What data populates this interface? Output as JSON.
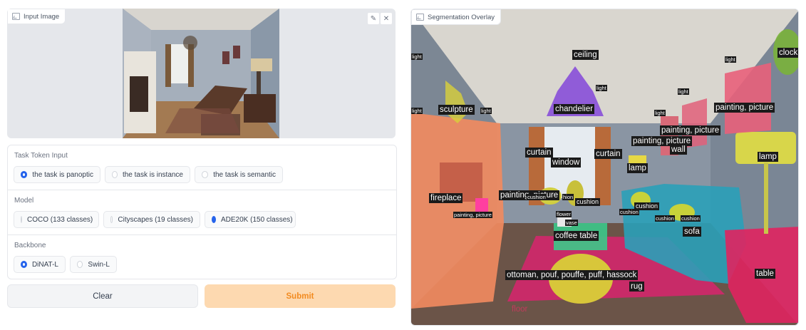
{
  "input_panel": {
    "label": "Input Image",
    "icon": "image-icon",
    "edit_icon": "pencil-icon",
    "close_icon": "close-icon"
  },
  "task": {
    "title": "Task Token Input",
    "options": [
      {
        "label": "the task is panoptic",
        "selected": true
      },
      {
        "label": "the task is instance",
        "selected": false
      },
      {
        "label": "the task is semantic",
        "selected": false
      }
    ]
  },
  "model": {
    "title": "Model",
    "options": [
      {
        "label": "COCO (133 classes)",
        "selected": false
      },
      {
        "label": "Cityscapes (19 classes)",
        "selected": false
      },
      {
        "label": "ADE20K (150 classes)",
        "selected": true
      }
    ]
  },
  "backbone": {
    "title": "Backbone",
    "options": [
      {
        "label": "DiNAT-L",
        "selected": true
      },
      {
        "label": "Swin-L",
        "selected": false
      }
    ]
  },
  "buttons": {
    "clear": "Clear",
    "submit": "Submit"
  },
  "output_panel": {
    "label": "Segmentation Overlay",
    "icon": "image-icon",
    "segments": {
      "ceiling": "ceiling",
      "clock": "clock",
      "chandelier": "chandelier",
      "sculpture": "sculpture",
      "light_1": "light",
      "light_2": "light",
      "light_3": "light",
      "light_4": "light",
      "light_5": "light",
      "light_6": "light",
      "light_7": "light",
      "painting_1": "painting, picture",
      "painting_2": "painting, picture",
      "painting_3": "painting, picture",
      "painting_4": "painting, picture",
      "painting_5": "painting, picture",
      "wall": "wall",
      "curtain_1": "curtain",
      "curtain_2": "curtain",
      "window": "window",
      "lamp_1": "lamp",
      "lamp_2": "lamp",
      "fireplace": "fireplace",
      "cushion_1": "cushion",
      "cushion_2": "cushion",
      "cushion_3": "cushion",
      "cushion_4": "cushion",
      "cushion_5": "cushion",
      "cushion_6": "cushion",
      "flower": "flower",
      "vase": "vase",
      "coffee_table": "coffee table",
      "sofa": "sofa",
      "ottoman": "ottoman, pouf, pouffe, puff, hassock",
      "rug": "rug",
      "table": "table",
      "floor": "floor",
      "hion": "hion"
    }
  }
}
